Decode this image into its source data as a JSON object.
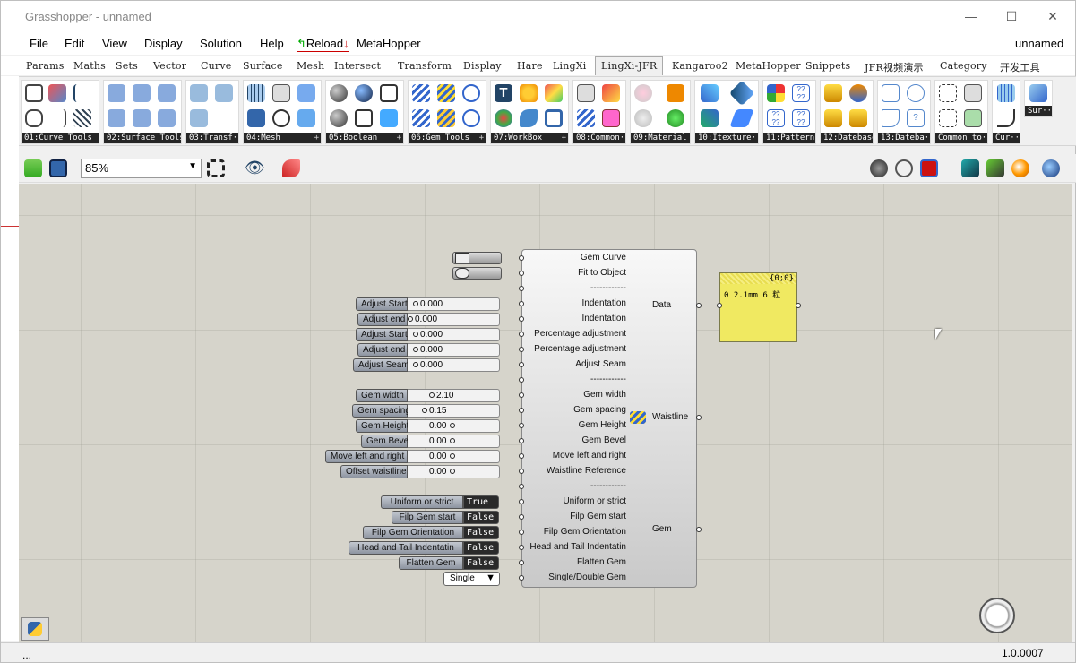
{
  "window": {
    "title": "Grasshopper - unnamed",
    "doc_name": "unnamed",
    "version": "1.0.0007",
    "status_left": "..."
  },
  "menu": [
    "File",
    "Edit",
    "View",
    "Display",
    "Solution",
    "Help",
    "Reload",
    "MetaHopper"
  ],
  "tabs": [
    "Params",
    "Maths",
    "Sets",
    "Vector",
    "Curve",
    "Surface",
    "Mesh",
    "Intersect",
    "Transform",
    "Display",
    "Hare",
    "LingXi",
    "LingXi-JFR",
    "Kangaroo2",
    "MetaHopper",
    "Snippets",
    "JFR视频演示",
    "Category",
    "开发工具"
  ],
  "active_tab": "LingXi-JFR",
  "ribbon_groups": [
    "01:Curve Tools",
    "02:Surface Tools",
    "03:Transf···",
    "04:Mesh",
    "05:Boolean",
    "06:Gem Tools",
    "07:WorkBox",
    "08:Common···",
    "09:Material",
    "10:Itexture···",
    "11:Pattern",
    "12:Datebase",
    "13:Dateba···",
    "Common to···",
    "Cur···",
    "Sur···"
  ],
  "toolbar": {
    "zoom": "85%"
  },
  "component": {
    "inputs": [
      "Gem Curve",
      "Fit to Object",
      "------------",
      "Indentation",
      "Indentation",
      "Percentage adjustment",
      "Percentage adjustment",
      "Adjust Seam",
      "------------",
      "Gem width",
      "Gem spacing",
      "Gem Height",
      "Gem Bevel",
      "Move left and right",
      "Waistline Reference",
      "------------",
      "Uniform or strict",
      "Filp Gem start",
      "Filp Gem Orientation",
      "Head and Tail Indentatin",
      "Flatten Gem",
      "Single/Double Gem"
    ],
    "outputs": [
      "Data",
      "Waistline",
      "Gem"
    ]
  },
  "sliders": [
    {
      "name": "Adjust Start",
      "value": "0.000"
    },
    {
      "name": "Adjust end",
      "value": "0.000"
    },
    {
      "name": "Adjust Start",
      "value": "0.000"
    },
    {
      "name": "Adjust end",
      "value": "0.000"
    },
    {
      "name": "Adjust Seam",
      "value": "0.000"
    },
    {
      "name": "Gem width",
      "value": "2.10"
    },
    {
      "name": "Gem spacing",
      "value": "0.15"
    },
    {
      "name": "Gem Height",
      "value": "0.00"
    },
    {
      "name": "Gem Bevel",
      "value": "0.00"
    },
    {
      "name": "Move left and right",
      "value": "0.00"
    },
    {
      "name": "Offset waistline",
      "value": "0.00"
    }
  ],
  "toggles": [
    {
      "name": "Uniform or strict",
      "value": "True"
    },
    {
      "name": "Filp Gem start",
      "value": "False"
    },
    {
      "name": "Filp Gem Orientation",
      "value": "False"
    },
    {
      "name": "Head and Tail Indentatin",
      "value": "False"
    },
    {
      "name": "Flatten Gem",
      "value": "False"
    }
  ],
  "value_list": {
    "value": "Single"
  },
  "panel": {
    "header": "{0;0}",
    "index": "0",
    "text": "2.1mm 6 粒"
  }
}
